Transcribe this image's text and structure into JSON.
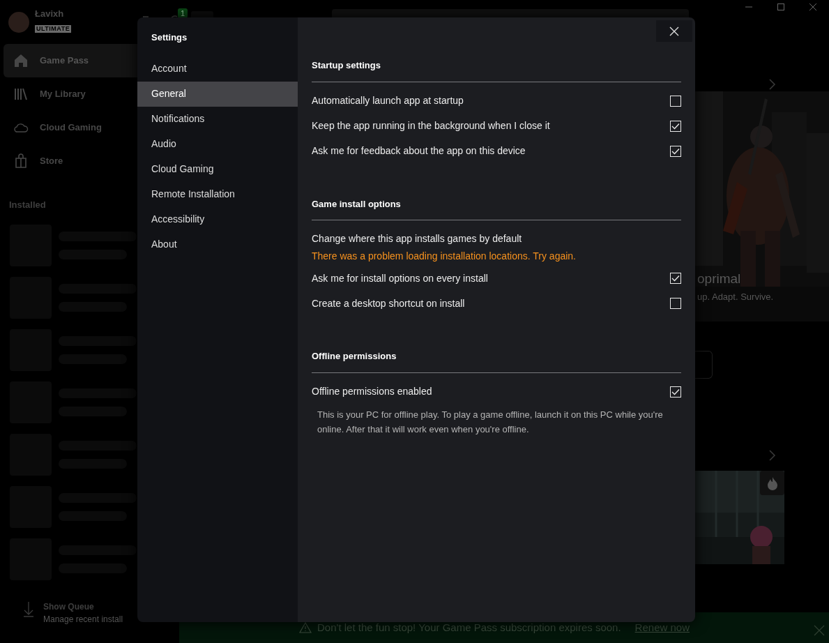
{
  "profile": {
    "name": "Łavixh",
    "tier": "ULTIMATE",
    "notification_count": "1"
  },
  "nav": [
    {
      "label": "Game Pass",
      "selected": true
    },
    {
      "label": "My Library",
      "selected": false
    },
    {
      "label": "Cloud Gaming",
      "selected": false
    },
    {
      "label": "Store",
      "selected": false
    }
  ],
  "installed": {
    "title": "Installed"
  },
  "queue": {
    "title": "Show Queue",
    "subtitle": "Manage recent install"
  },
  "featured": {
    "title": "oprimal",
    "tagline": "up. Adapt. Survive."
  },
  "banner": {
    "message": "Don't let the fun stop! Your Game Pass subscription expires soon.",
    "link": "Renew now"
  },
  "settings": {
    "title": "Settings",
    "menu": [
      {
        "label": "Account",
        "selected": false
      },
      {
        "label": "General",
        "selected": true
      },
      {
        "label": "Notifications",
        "selected": false
      },
      {
        "label": "Audio",
        "selected": false
      },
      {
        "label": "Cloud Gaming",
        "selected": false
      },
      {
        "label": "Remote Installation",
        "selected": false
      },
      {
        "label": "Accessibility",
        "selected": false
      },
      {
        "label": "About",
        "selected": false
      }
    ],
    "sections": [
      {
        "title": "Startup settings",
        "items": [
          {
            "kind": "checkbox",
            "label": "Automatically launch app at startup",
            "checked": false
          },
          {
            "kind": "checkbox",
            "label": "Keep the app running in the background when I close it",
            "checked": true
          },
          {
            "kind": "checkbox",
            "label": "Ask me for feedback about the app on this device",
            "checked": true
          }
        ]
      },
      {
        "title": "Game install options",
        "items": [
          {
            "kind": "text",
            "label": "Change where this app installs games by default"
          },
          {
            "kind": "error",
            "label": "There was a problem loading installation locations. Try again."
          },
          {
            "kind": "checkbox",
            "label": "Ask me for install options on every install",
            "checked": true
          },
          {
            "kind": "checkbox",
            "label": "Create a desktop shortcut on install",
            "checked": false
          }
        ]
      },
      {
        "title": "Offline permissions",
        "items": [
          {
            "kind": "checkbox",
            "label": "Offline permissions enabled",
            "checked": true,
            "description": "This is your PC for offline play. To play a game offline, launch it on this PC while you're online. After that it will work even when you're offline."
          }
        ]
      }
    ]
  }
}
